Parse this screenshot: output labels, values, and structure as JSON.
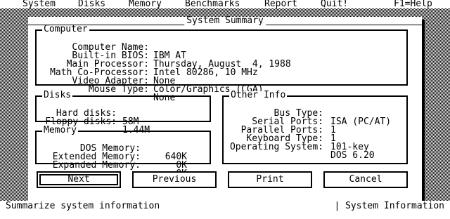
{
  "menubar": {
    "items": [
      "System",
      "Disks",
      "Memory",
      "Benchmarks",
      "Report",
      "Quit!"
    ],
    "help": "F1=Help"
  },
  "window": {
    "title": "System Summary"
  },
  "computer": {
    "title": "Computer",
    "rows": [
      {
        "label": "Computer Name:",
        "value": "IBM AT"
      },
      {
        "label": "Built-in BIOS:",
        "value": "Thursday, August  4, 1988"
      },
      {
        "label": "Main Processor:",
        "value": "Intel 80286, 10 MHz"
      },
      {
        "label": "Math Co-Processor:",
        "value": "None"
      },
      {
        "label": "Video Adapter:",
        "value": "Color/Graphics (CGA)"
      },
      {
        "label": "Mouse Type:",
        "value": "None"
      }
    ]
  },
  "disks": {
    "title": "Disks",
    "rows": [
      {
        "label": "Hard disks:",
        "value": "58M"
      },
      {
        "label": "Floppy disks:",
        "value": "1.44M"
      }
    ]
  },
  "memory": {
    "title": "Memory",
    "rows": [
      {
        "label": "DOS Memory:",
        "value": "640K"
      },
      {
        "label": "Extended Memory:",
        "value": "0K"
      },
      {
        "label": "Expanded Memory:",
        "value": "0K"
      }
    ]
  },
  "other": {
    "title": "Other Info",
    "rows": [
      {
        "label": "Bus Type:",
        "value": "ISA (PC/AT)"
      },
      {
        "label": "Serial Ports:",
        "value": "1"
      },
      {
        "label": "Parallel Ports:",
        "value": "1"
      },
      {
        "label": "Keyboard Type:",
        "value": "101-key"
      },
      {
        "label": "Operating System:",
        "value": "DOS 6.20"
      }
    ]
  },
  "buttons": {
    "next": "Next",
    "previous": "Previous",
    "print": "Print",
    "cancel": "Cancel"
  },
  "status": {
    "left": "Summarize system information",
    "right": "| System Information"
  }
}
